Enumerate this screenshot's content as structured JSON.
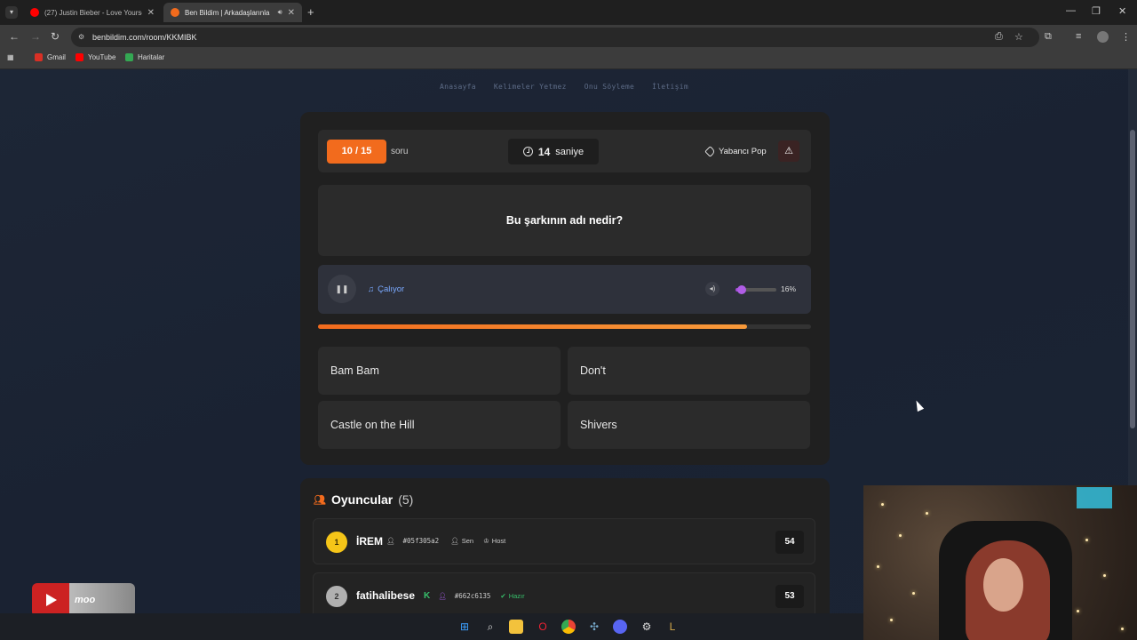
{
  "browser": {
    "tabs": [
      {
        "title": "(27) Justin Bieber - Love Yourse",
        "favicon_color": "#ff0000",
        "active": false
      },
      {
        "title": "Ben Bildim | Arkadaşlarınla",
        "favicon_color": "#f26b1d",
        "active": true
      }
    ],
    "url": "benbildim.com/room/KKMIBK",
    "bookmarks": [
      {
        "label": "Gmail",
        "icon_color": "#d93025"
      },
      {
        "label": "YouTube",
        "icon_color": "#ff0000"
      },
      {
        "label": "Haritalar",
        "icon_color": "#34a853"
      }
    ]
  },
  "site": {
    "nav": [
      "Anasayfa",
      "Kelimeler Yetmez",
      "Onu Söyleme",
      "İletişim"
    ]
  },
  "game": {
    "counter": "10 / 15",
    "counter_label": "soru",
    "timer_value": "14",
    "timer_unit": "saniye",
    "category": "Yabancı Pop",
    "question": "Bu şarkının adı nedir?",
    "player_status": "Çalıyor",
    "volume_label": "16%",
    "volume_fraction": 0.16,
    "song_progress_fraction": 0.87,
    "answers": [
      "Bam Bam",
      "Don't",
      "Castle on the Hill",
      "Shivers"
    ],
    "accent_color": "#f26b1d"
  },
  "players": {
    "title": "Oyuncular",
    "count": "(5)",
    "list": [
      {
        "rank": "1",
        "name": "İREM",
        "id": "#05f305a2",
        "badge1": "Sen",
        "badge2": "Host",
        "score": "54",
        "rank_color": "#f5c518"
      },
      {
        "rank": "2",
        "name": "fatihalibese",
        "id": "#662c6135",
        "badge1": "Hazır",
        "badge2": "",
        "score": "53",
        "rank_color": "#b0b0b0"
      }
    ]
  },
  "overlay": {
    "yt_label": "moo"
  }
}
